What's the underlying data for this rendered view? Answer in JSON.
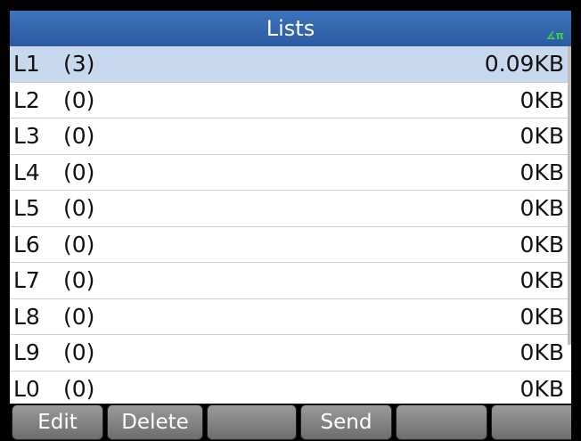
{
  "header": {
    "title": "Lists",
    "angle_mode_icon": "angle-radians-icon",
    "angle_glyph": "∡π"
  },
  "lists": [
    {
      "name": "L1",
      "count": "(3)",
      "size": "0.09KB",
      "selected": true
    },
    {
      "name": "L2",
      "count": "(0)",
      "size": "0KB"
    },
    {
      "name": "L3",
      "count": "(0)",
      "size": "0KB"
    },
    {
      "name": "L4",
      "count": "(0)",
      "size": "0KB"
    },
    {
      "name": "L5",
      "count": "(0)",
      "size": "0KB"
    },
    {
      "name": "L6",
      "count": "(0)",
      "size": "0KB"
    },
    {
      "name": "L7",
      "count": "(0)",
      "size": "0KB"
    },
    {
      "name": "L8",
      "count": "(0)",
      "size": "0KB"
    },
    {
      "name": "L9",
      "count": "(0)",
      "size": "0KB"
    },
    {
      "name": "L0",
      "count": "(0)",
      "size": "0KB"
    }
  ],
  "softkeys": [
    "Edit",
    "Delete",
    "",
    "Send",
    "",
    ""
  ],
  "colors": {
    "title_bar": "#2f63ad",
    "selection": "#c7d8ef",
    "angle_indicator": "#39d34a",
    "softkey": "#8a8a8a"
  }
}
